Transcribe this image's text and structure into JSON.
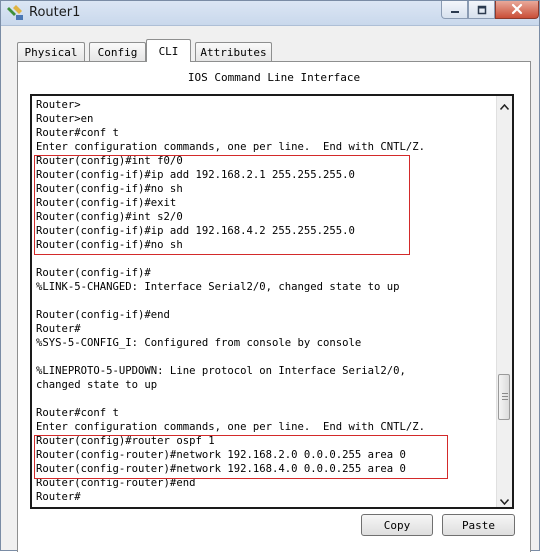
{
  "window": {
    "title": "Router1",
    "icon": "router-config-icon",
    "controls": [
      "minimize-icon",
      "maximize-icon",
      "close-icon"
    ]
  },
  "tabs": [
    {
      "label": "Physical",
      "active": false
    },
    {
      "label": "Config",
      "active": false
    },
    {
      "label": "CLI",
      "active": true
    },
    {
      "label": "Attributes",
      "active": false
    }
  ],
  "panel": {
    "title": "IOS Command Line Interface"
  },
  "terminal": {
    "lines": [
      "Router>",
      "Router>en",
      "Router#conf t",
      "Enter configuration commands, one per line.  End with CNTL/Z.",
      "Router(config)#int f0/0",
      "Router(config-if)#ip add 192.168.2.1 255.255.255.0",
      "Router(config-if)#no sh",
      "Router(config-if)#exit",
      "Router(config)#int s2/0",
      "Router(config-if)#ip add 192.168.4.2 255.255.255.0",
      "Router(config-if)#no sh",
      "",
      "Router(config-if)#",
      "%LINK-5-CHANGED: Interface Serial2/0, changed state to up",
      "",
      "Router(config-if)#end",
      "Router#",
      "%SYS-5-CONFIG_I: Configured from console by console",
      "",
      "%LINEPROTO-5-UPDOWN: Line protocol on Interface Serial2/0,",
      "changed state to up",
      "",
      "Router#conf t",
      "Enter configuration commands, one per line.  End with CNTL/Z.",
      "Router(config)#router ospf 1",
      "Router(config-router)#network 192.168.2.0 0.0.0.255 area 0",
      "Router(config-router)#network 192.168.4.0 0.0.0.255 area 0",
      "Router(config-router)#end",
      "Router#"
    ],
    "highlight_color": "#d32a2a"
  },
  "buttons": {
    "copy": "Copy",
    "paste": "Paste"
  }
}
